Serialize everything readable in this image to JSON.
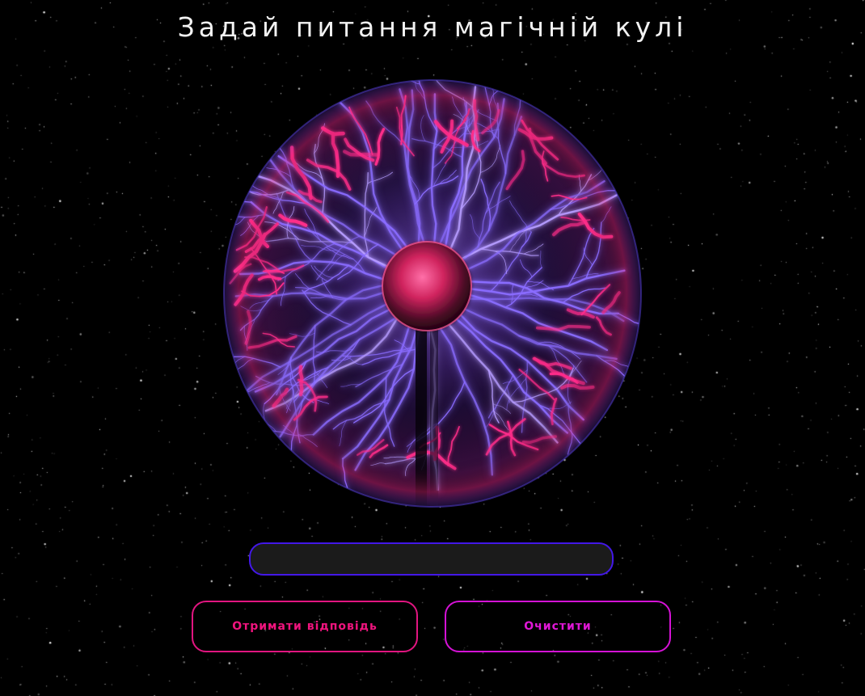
{
  "page": {
    "title": "Задай питання магічній кулі"
  },
  "question_input": {
    "value": "",
    "placeholder": ""
  },
  "buttons": {
    "get_answer_label": "Отримати відповідь",
    "clear_label": "Очистити"
  },
  "colors": {
    "background": "#000000",
    "title_text": "#f2f2f2",
    "input_border": "#4318e8",
    "input_background": "#1b1b1b",
    "answer_button_accent": "#e21580",
    "clear_button_accent": "#d512d6",
    "plasma_violet": "#8a6cff",
    "plasma_pink": "#ff2d8a"
  },
  "images": {
    "background": "starfield",
    "centerpiece": "plasma-ball"
  }
}
